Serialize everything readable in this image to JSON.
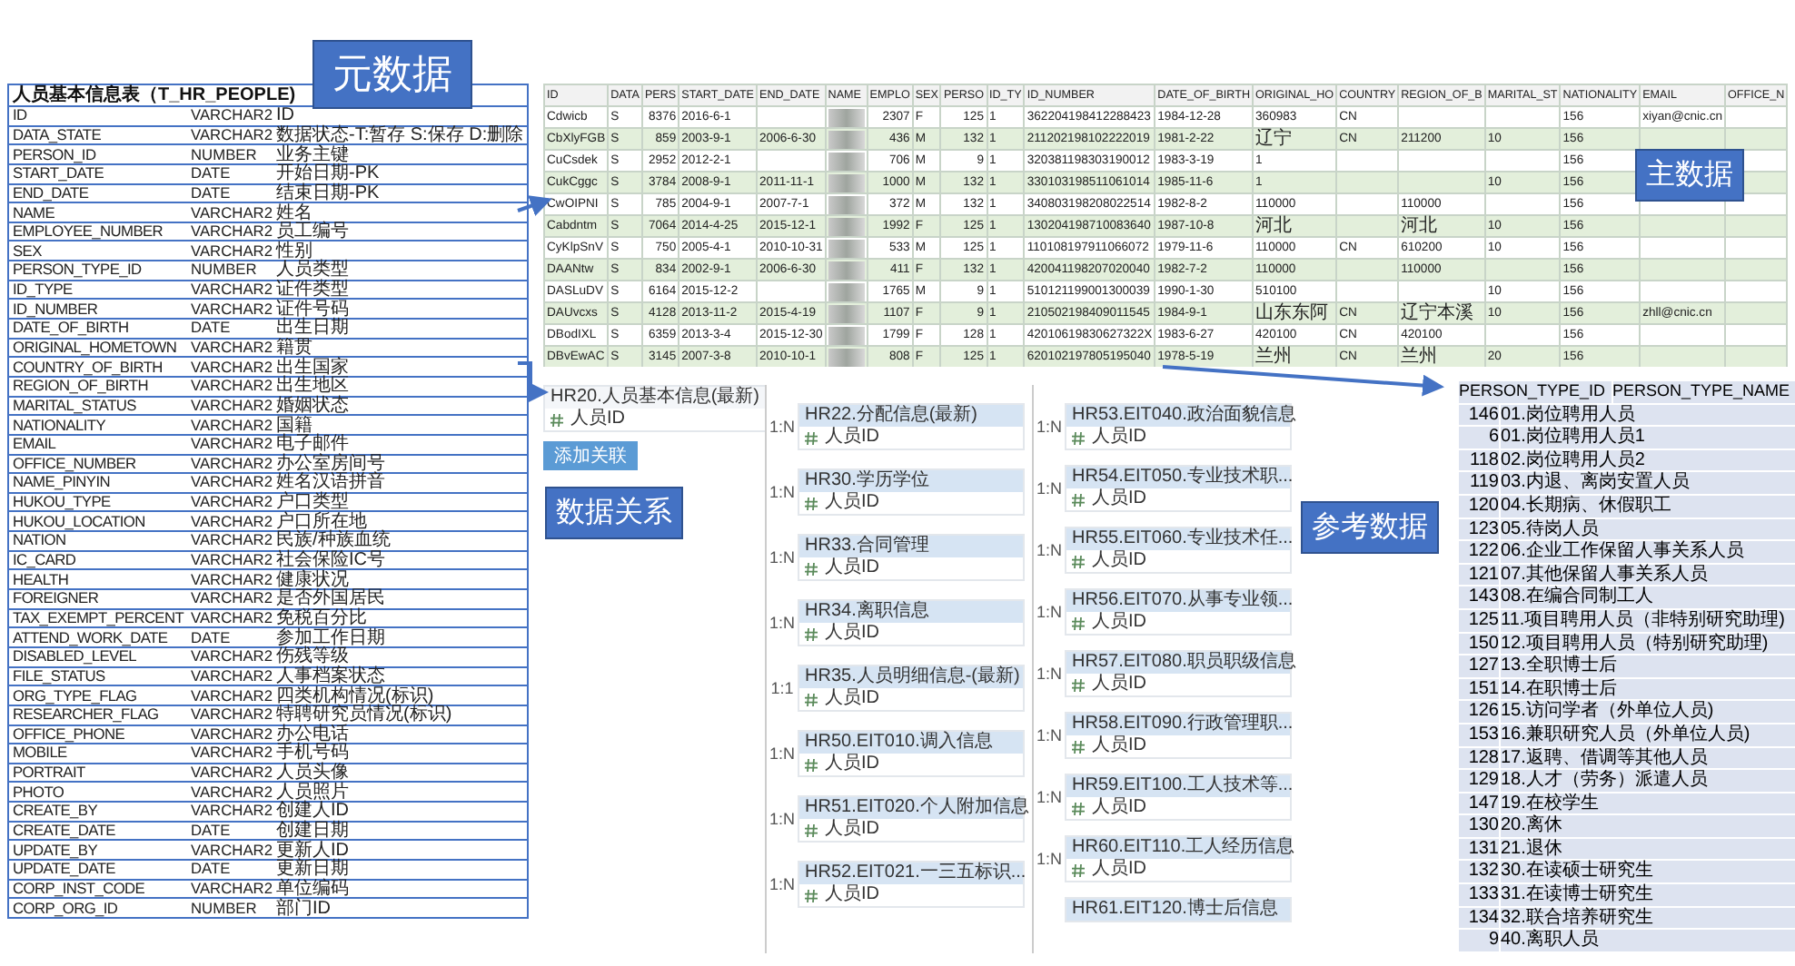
{
  "callouts": [
    {
      "text": "元数据"
    },
    {
      "text": "主数据"
    },
    {
      "text": "数据关系"
    },
    {
      "text": "参考数据"
    }
  ],
  "metadata_table": {
    "title": "人员基本信息表（T_HR_PEOPLE)",
    "rows": [
      [
        "ID",
        "VARCHAR2",
        "ID"
      ],
      [
        "DATA_STATE",
        "VARCHAR2",
        "数据状态-T:暂存 S:保存 D:删除"
      ],
      [
        "PERSON_ID",
        "NUMBER",
        "业务主键"
      ],
      [
        "START_DATE",
        "DATE",
        "开始日期-PK"
      ],
      [
        "END_DATE",
        "DATE",
        "结束日期-PK"
      ],
      [
        "NAME",
        "VARCHAR2",
        "姓名"
      ],
      [
        "EMPLOYEE_NUMBER",
        "VARCHAR2",
        "员工编号"
      ],
      [
        "SEX",
        "VARCHAR2",
        "性别"
      ],
      [
        "PERSON_TYPE_ID",
        "NUMBER",
        "人员类型"
      ],
      [
        "ID_TYPE",
        "VARCHAR2",
        "证件类型"
      ],
      [
        "ID_NUMBER",
        "VARCHAR2",
        "证件号码"
      ],
      [
        "DATE_OF_BIRTH",
        "DATE",
        "出生日期"
      ],
      [
        "ORIGINAL_HOMETOWN",
        "VARCHAR2",
        "籍贯"
      ],
      [
        "COUNTRY_OF_BIRTH",
        "VARCHAR2",
        "出生国家"
      ],
      [
        "REGION_OF_BIRTH",
        "VARCHAR2",
        "出生地区"
      ],
      [
        "MARITAL_STATUS",
        "VARCHAR2",
        "婚姻状态"
      ],
      [
        "NATIONALITY",
        "VARCHAR2",
        "国籍"
      ],
      [
        "EMAIL",
        "VARCHAR2",
        "电子邮件"
      ],
      [
        "OFFICE_NUMBER",
        "VARCHAR2",
        "办公室房间号"
      ],
      [
        "NAME_PINYIN",
        "VARCHAR2",
        "姓名汉语拼音"
      ],
      [
        "HUKOU_TYPE",
        "VARCHAR2",
        "户口类型"
      ],
      [
        "HUKOU_LOCATION",
        "VARCHAR2",
        "户口所在地"
      ],
      [
        "NATION",
        "VARCHAR2",
        "民族/种族血统"
      ],
      [
        "IC_CARD",
        "VARCHAR2",
        "社会保险IC号"
      ],
      [
        "HEALTH",
        "VARCHAR2",
        "健康状况"
      ],
      [
        "FOREIGNER",
        "VARCHAR2",
        "是否外国居民"
      ],
      [
        "TAX_EXEMPT_PERCENT",
        "VARCHAR2",
        "免税百分比"
      ],
      [
        "ATTEND_WORK_DATE",
        "DATE",
        "参加工作日期"
      ],
      [
        "DISABLED_LEVEL",
        "VARCHAR2",
        "伤残等级"
      ],
      [
        "FILE_STATUS",
        "VARCHAR2",
        "人事档案状态"
      ],
      [
        "ORG_TYPE_FLAG",
        "VARCHAR2",
        "四类机构情况(标识)"
      ],
      [
        "RESEARCHER_FLAG",
        "VARCHAR2",
        "特聘研究员情况(标识)"
      ],
      [
        "OFFICE_PHONE",
        "VARCHAR2",
        "办公电话"
      ],
      [
        "MOBILE",
        "VARCHAR2",
        "手机号码"
      ],
      [
        "PORTRAIT",
        "VARCHAR2",
        "人员头像"
      ],
      [
        "PHOTO",
        "VARCHAR2",
        "人员照片"
      ],
      [
        "CREATE_BY",
        "VARCHAR2",
        "创建人ID"
      ],
      [
        "CREATE_DATE",
        "DATE",
        "创建日期"
      ],
      [
        "UPDATE_BY",
        "VARCHAR2",
        "更新人ID"
      ],
      [
        "UPDATE_DATE",
        "DATE",
        "更新日期"
      ],
      [
        "CORP_INST_CODE",
        "VARCHAR2",
        "单位编码"
      ],
      [
        "CORP_ORG_ID",
        "NUMBER",
        "部门ID"
      ]
    ]
  },
  "master_data": {
    "columns": [
      {
        "label": "ID",
        "kind": "text"
      },
      {
        "label": "DATA",
        "kind": "text"
      },
      {
        "label": "PERS",
        "kind": "number"
      },
      {
        "label": "START_DATE",
        "kind": "text"
      },
      {
        "label": "END_DATE",
        "kind": "text"
      },
      {
        "label": "NAME",
        "kind": "blurred"
      },
      {
        "label": "EMPLO",
        "kind": "number"
      },
      {
        "label": "SEX",
        "kind": "text"
      },
      {
        "label": "PERSO",
        "kind": "number"
      },
      {
        "label": "ID_TY",
        "kind": "text"
      },
      {
        "label": "ID_NUMBER",
        "kind": "text"
      },
      {
        "label": "DATE_OF_BIRTH",
        "kind": "text"
      },
      {
        "label": "ORIGINAL_HO",
        "kind": "text"
      },
      {
        "label": "COUNTRY",
        "kind": "text"
      },
      {
        "label": "REGION_OF_B",
        "kind": "text"
      },
      {
        "label": "MARITAL_ST",
        "kind": "text"
      },
      {
        "label": "NATIONALITY",
        "kind": "text"
      },
      {
        "label": "EMAIL",
        "kind": "text"
      },
      {
        "label": "OFFICE_N",
        "kind": "text"
      }
    ],
    "rows": [
      [
        "Cdwicb",
        "S",
        "8376",
        "2016-6-1",
        null,
        null,
        "2307",
        "F",
        "125",
        "1",
        "362204198412288423",
        "1984-12-28",
        "360983",
        "CN",
        null,
        null,
        "156",
        "xiyan@cnic.cn",
        null
      ],
      [
        "CbXlyFGB",
        "S",
        "859",
        "2003-9-1",
        "2006-6-30",
        null,
        "436",
        "M",
        "132",
        "1",
        "211202198102222019",
        "1981-2-22",
        "辽宁",
        "CN",
        "211200",
        "10",
        "156",
        null,
        null
      ],
      [
        "CuCsdek",
        "S",
        "2952",
        "2012-2-1",
        null,
        null,
        "706",
        "M",
        "9",
        "1",
        "320381198303190012",
        "1983-3-19",
        "1",
        null,
        null,
        null,
        "156",
        null,
        null
      ],
      [
        "CukCggc",
        "S",
        "3784",
        "2008-9-1",
        "2011-11-1",
        null,
        "1000",
        "M",
        "132",
        "1",
        "330103198511061014",
        "1985-11-6",
        "1",
        null,
        null,
        "10",
        "156",
        null,
        null
      ],
      [
        "CwOIPNI",
        "S",
        "785",
        "2004-9-1",
        "2007-7-1",
        null,
        "372",
        "M",
        "132",
        "1",
        "340803198208022514",
        "1982-8-2",
        "110000",
        null,
        "110000",
        null,
        "156",
        null,
        null
      ],
      [
        "Cabdntm",
        "S",
        "7064",
        "2014-4-25",
        "2015-12-1",
        null,
        "1992",
        "F",
        "125",
        "1",
        "130204198710083640",
        "1987-10-8",
        "河北",
        null,
        "河北",
        "10",
        "156",
        null,
        null
      ],
      [
        "CyKlpSnV",
        "S",
        "750",
        "2005-4-1",
        "2010-10-31",
        null,
        "533",
        "M",
        "125",
        "1",
        "110108197911066072",
        "1979-11-6",
        "110000",
        "CN",
        "610200",
        "10",
        "156",
        null,
        null
      ],
      [
        "DAANtw",
        "S",
        "834",
        "2002-9-1",
        "2006-6-30",
        null,
        "411",
        "F",
        "132",
        "1",
        "420041198207020040",
        "1982-7-2",
        "110000",
        null,
        "110000",
        null,
        "156",
        null,
        null
      ],
      [
        "DASLuDV",
        "S",
        "6164",
        "2015-12-2",
        null,
        null,
        "1765",
        "M",
        "9",
        "1",
        "510121199001300039",
        "1990-1-30",
        "510100",
        null,
        null,
        "10",
        "156",
        null,
        null
      ],
      [
        "DAUvcxs",
        "S",
        "4128",
        "2013-11-2",
        "2015-4-19",
        null,
        "1107",
        "F",
        "9",
        "1",
        "210502198409011545",
        "1984-9-1",
        "山东东阿",
        "CN",
        "辽宁本溪",
        "10",
        "156",
        "zhll@cnic.cn",
        null
      ],
      [
        "DBodIXL",
        "S",
        "6359",
        "2013-3-4",
        "2015-12-30",
        null,
        "1799",
        "F",
        "128",
        "1",
        "42010619830627322X",
        "1983-6-27",
        "420100",
        "CN",
        "420100",
        null,
        "156",
        null,
        null
      ],
      [
        "DBvEwAC",
        "S",
        "3145",
        "2007-3-8",
        "2010-10-1",
        null,
        "808",
        "F",
        "125",
        "1",
        "620102197805195040",
        "1978-5-19",
        "兰州",
        "CN",
        "兰州",
        "20",
        "156",
        null,
        null
      ]
    ]
  },
  "relations": {
    "root": {
      "title": "HR20.人员基本信息(最新)",
      "field": "人员ID"
    },
    "add_button": "添加关联",
    "columns": [
      [
        {
          "title": "HR22.分配信息(最新)",
          "field": "人员ID",
          "cardinality": "1:N"
        },
        {
          "title": "HR30.学历学位",
          "field": "人员ID",
          "cardinality": "1:N"
        },
        {
          "title": "HR33.合同管理",
          "field": "人员ID",
          "cardinality": "1:N"
        },
        {
          "title": "HR34.离职信息",
          "field": "人员ID",
          "cardinality": "1:N"
        },
        {
          "title": "HR35.人员明细信息-(最新)",
          "field": "人员ID",
          "cardinality": "1:1"
        },
        {
          "title": "HR50.EIT010.调入信息",
          "field": "人员ID",
          "cardinality": "1:N"
        },
        {
          "title": "HR51.EIT020.个人附加信息",
          "field": "人员ID",
          "cardinality": "1:N"
        },
        {
          "title": "HR52.EIT021.一三五标识...",
          "field": "人员ID",
          "cardinality": "1:N"
        }
      ],
      [
        {
          "title": "HR53.EIT040.政治面貌信息",
          "field": "人员ID",
          "cardinality": "1:N"
        },
        {
          "title": "HR54.EIT050.专业技术职...",
          "field": "人员ID",
          "cardinality": "1:N"
        },
        {
          "title": "HR55.EIT060.专业技术任...",
          "field": "人员ID",
          "cardinality": "1:N"
        },
        {
          "title": "HR56.EIT070.从事专业领...",
          "field": "人员ID",
          "cardinality": "1:N"
        },
        {
          "title": "HR57.EIT080.职员职级信息",
          "field": "人员ID",
          "cardinality": "1:N"
        },
        {
          "title": "HR58.EIT090.行政管理职...",
          "field": "人员ID",
          "cardinality": "1:N"
        },
        {
          "title": "HR59.EIT100.工人技术等...",
          "field": "人员ID",
          "cardinality": "1:N"
        },
        {
          "title": "HR60.EIT110.工人经历信息",
          "field": "人员ID",
          "cardinality": "1:N"
        },
        {
          "title": "HR61.EIT120.博士后信息"
        }
      ]
    ]
  },
  "reference_table": {
    "columns": [
      "PERSON_TYPE_ID",
      "PERSON_TYPE_NAME"
    ],
    "rows": [
      [
        "146",
        "01.岗位聘用人员"
      ],
      [
        "6",
        "01.岗位聘用人员1"
      ],
      [
        "118",
        "02.岗位聘用人员2"
      ],
      [
        "119",
        "03.内退、离岗安置人员"
      ],
      [
        "120",
        "04.长期病、休假职工"
      ],
      [
        "123",
        "05.待岗人员"
      ],
      [
        "122",
        "06.企业工作保留人事关系人员"
      ],
      [
        "121",
        "07.其他保留人事关系人员"
      ],
      [
        "143",
        "08.在编合同制工人"
      ],
      [
        "125",
        "11.项目聘用人员（非特别研究助理)"
      ],
      [
        "150",
        "12.项目聘用人员（特别研究助理)"
      ],
      [
        "127",
        "13.全职博士后"
      ],
      [
        "151",
        "14.在职博士后"
      ],
      [
        "126",
        "15.访问学者（外单位人员)"
      ],
      [
        "153",
        "16.兼职研究人员（外单位人员)"
      ],
      [
        "128",
        "17.返聘、借调等其他人员"
      ],
      [
        "129",
        "18.人才（劳务）派遣人员"
      ],
      [
        "147",
        "19.在校学生"
      ],
      [
        "130",
        "20.离休"
      ],
      [
        "131",
        "21.退休"
      ],
      [
        "132",
        "30.在读硕士研究生"
      ],
      [
        "133",
        "31.在读博士研究生"
      ],
      [
        "134",
        "32.联合培养研究生"
      ],
      [
        "9",
        "40.离职人员"
      ]
    ]
  }
}
